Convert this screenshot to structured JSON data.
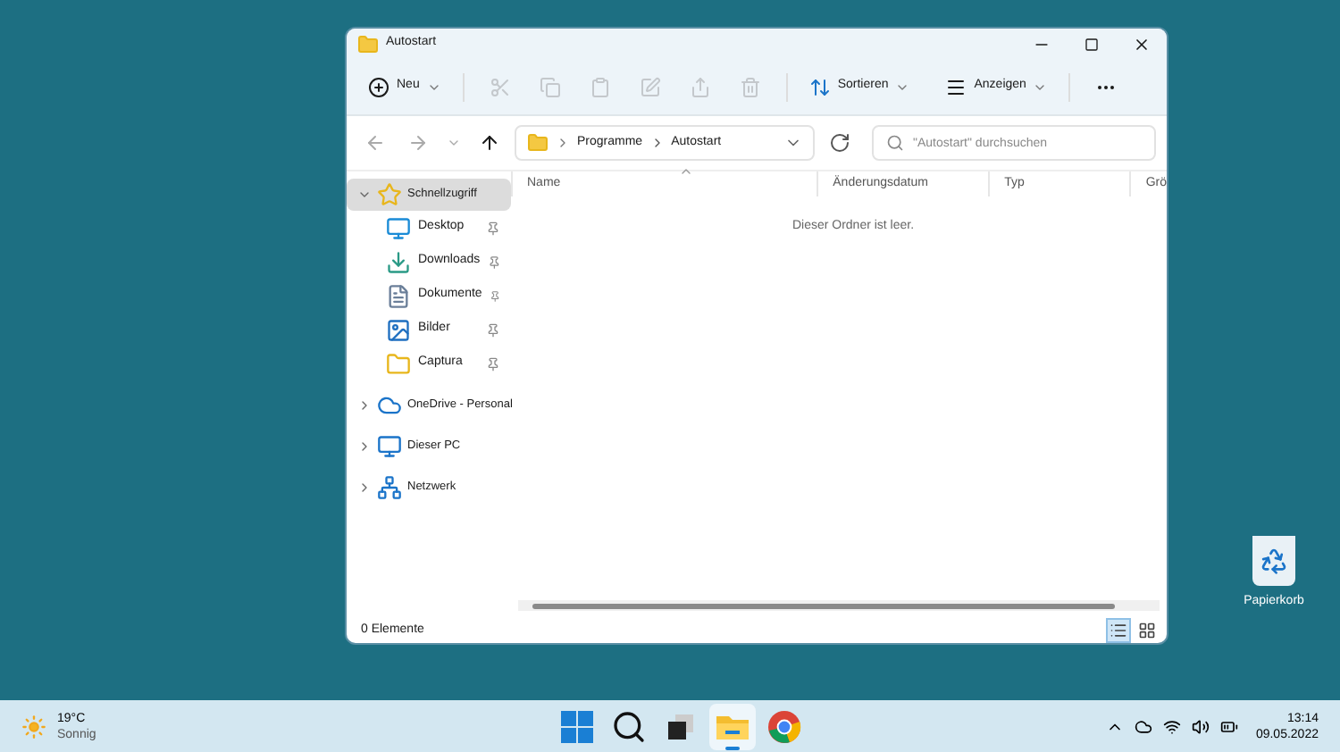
{
  "window": {
    "title": "Autostart"
  },
  "toolbar": {
    "new_label": "Neu",
    "actions": [
      {
        "kind": "cut",
        "disabled": true
      },
      {
        "kind": "copy",
        "disabled": true
      },
      {
        "kind": "paste",
        "disabled": true
      },
      {
        "kind": "rename",
        "disabled": true
      },
      {
        "kind": "share",
        "disabled": true
      },
      {
        "kind": "delete",
        "disabled": true
      }
    ],
    "sort_label": "Sortieren",
    "view_label": "Anzeigen"
  },
  "address": {
    "crumbs": [
      "Programme",
      "Autostart"
    ],
    "search_placeholder": "\"Autostart\" durchsuchen"
  },
  "sidebar": {
    "items": [
      {
        "label": "Schnellzugriff",
        "kind": "star",
        "expanded": true,
        "selected": true,
        "children": [
          {
            "label": "Desktop",
            "kind": "desktop",
            "pinned": true
          },
          {
            "label": "Downloads",
            "kind": "download",
            "pinned": true
          },
          {
            "label": "Dokumente",
            "kind": "document",
            "pinned": true
          },
          {
            "label": "Bilder",
            "kind": "picture",
            "pinned": true
          },
          {
            "label": "Captura",
            "kind": "folder",
            "pinned": true
          }
        ]
      },
      {
        "label": "OneDrive - Personal",
        "kind": "cloud",
        "expanded": false,
        "selected": false
      },
      {
        "label": "Dieser PC",
        "kind": "pc",
        "expanded": false,
        "selected": false
      },
      {
        "label": "Netzwerk",
        "kind": "network",
        "expanded": false,
        "selected": false
      }
    ]
  },
  "table": {
    "columns": [
      "Name",
      "Änderungsdatum",
      "Typ",
      "Grö"
    ],
    "empty_message": "Dieser Ordner ist leer."
  },
  "status_bar": {
    "count": "0 Elemente",
    "views": [
      {
        "kind": "details",
        "selected": true
      },
      {
        "kind": "tiles",
        "selected": false
      }
    ]
  },
  "desktop_icons": [
    {
      "label": "Papierkorb"
    }
  ],
  "taskbar": {
    "weather": {
      "temperature": "19°C",
      "condition": "Sonnig"
    },
    "apps": [
      {
        "kind": "start",
        "active": false
      },
      {
        "kind": "search",
        "active": false
      },
      {
        "kind": "taskview",
        "active": false
      },
      {
        "kind": "explorer",
        "active": true
      },
      {
        "kind": "chrome",
        "active": false
      }
    ],
    "time": "13:14",
    "date": "09.05.2022"
  }
}
